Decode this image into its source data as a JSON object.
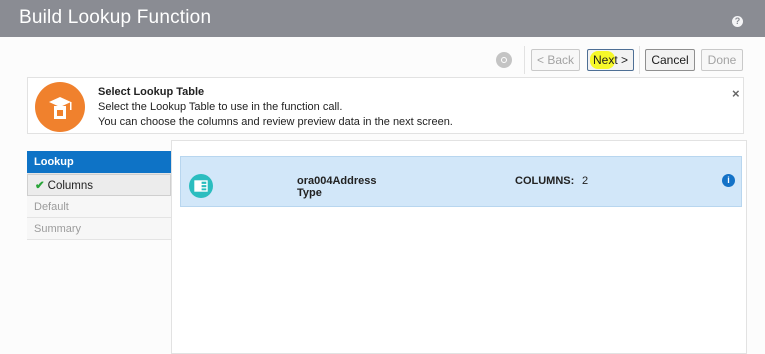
{
  "window": {
    "title": "Build Lookup Function",
    "help_glyph": "?"
  },
  "toolbar": {
    "back_label": "< Back",
    "next_label": "Next >",
    "cancel_label": "Cancel",
    "done_label": "Done"
  },
  "banner": {
    "title": "Select Lookup Table",
    "line1": "Select the Lookup Table to use in the function call.",
    "line2": "You can choose the columns and review preview data in the next screen.",
    "close_glyph": "×",
    "icon_color": "#f0812d"
  },
  "nav": {
    "items": [
      {
        "label": "Lookup",
        "state": "current"
      },
      {
        "label": "Columns",
        "state": "completed"
      },
      {
        "label": "Default",
        "state": "disabled"
      },
      {
        "label": "Summary",
        "state": "disabled"
      }
    ],
    "check_glyph": "✔"
  },
  "table": {
    "rows": [
      {
        "name": "ora004AddressType",
        "columns_label": "COLUMNS:",
        "columns_value": "2"
      }
    ],
    "info_glyph": "i"
  },
  "colors": {
    "accent": "#0e73c6",
    "selected_row": "#d2e7f9",
    "table_icon": "#2bbdbf",
    "highlight": "#f6f82a"
  }
}
